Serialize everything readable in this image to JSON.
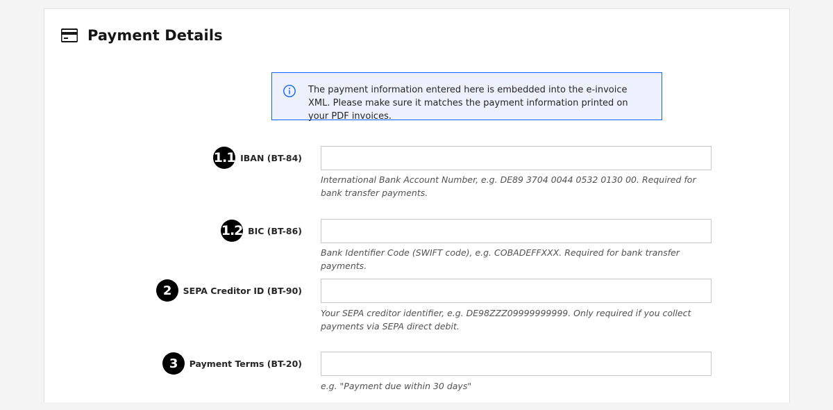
{
  "section": {
    "title": "Payment Details",
    "icon": "credit-card-icon"
  },
  "notice": {
    "icon": "info-icon",
    "text": "The payment information entered here is embedded into the e-invoice XML. Please make sure it matches the payment information printed on your PDF invoices.",
    "accent": "#0f62fe",
    "background": "#edf1fd"
  },
  "fields": [
    {
      "badge": "1.1",
      "label": "IBAN (BT-84)",
      "value": "",
      "helper": "International Bank Account Number, e.g. DE89 3704 0044 0532 0130 00. Required for bank transfer payments."
    },
    {
      "badge": "1.2",
      "label": "BIC (BT-86)",
      "value": "",
      "helper": "Bank Identifier Code (SWIFT code), e.g. COBADEFFXXX. Required for bank transfer payments."
    },
    {
      "badge": "2",
      "label": "SEPA Creditor ID (BT-90)",
      "value": "",
      "helper": "Your SEPA creditor identifier, e.g. DE98ZZZ09999999999. Only required if you collect payments via SEPA direct debit."
    },
    {
      "badge": "3",
      "label": "Payment Terms (BT-20)",
      "value": "",
      "helper": "e.g. \"Payment due within 30 days\""
    }
  ]
}
